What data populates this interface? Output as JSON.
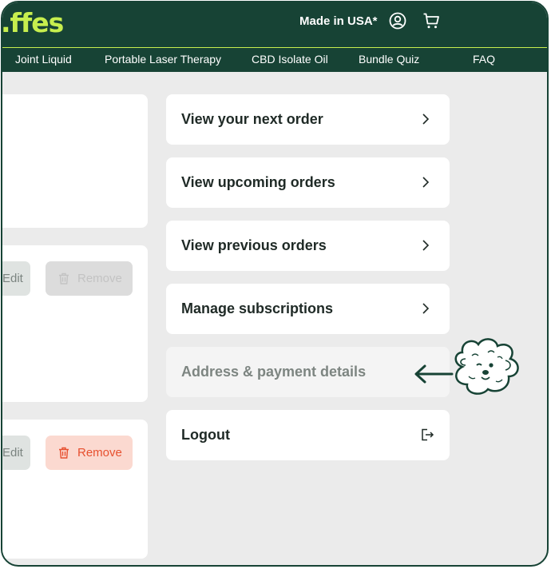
{
  "header": {
    "logo_text": ".ffes",
    "made_in": "Made in USA*"
  },
  "nav": {
    "items": [
      "Joint Liquid",
      "Portable Laser Therapy",
      "CBD Isolate Oil",
      "Bundle Quiz",
      "FAQ"
    ]
  },
  "subscriptions": {
    "edit_label": "Edit",
    "remove_label": "Remove"
  },
  "menu": {
    "items": [
      "View your next order",
      "View upcoming orders",
      "View previous orders",
      "Manage subscriptions",
      "Address & payment details",
      "Logout"
    ]
  },
  "colors": {
    "brand_dark": "#174335",
    "brand_lime": "#c7ee4e",
    "remove_red": "#e7502f"
  },
  "icons": [
    "user-icon",
    "cart-icon",
    "trash-icon",
    "chevron-right-icon",
    "logout-icon",
    "arrow-left-icon",
    "dog-mascot"
  ]
}
